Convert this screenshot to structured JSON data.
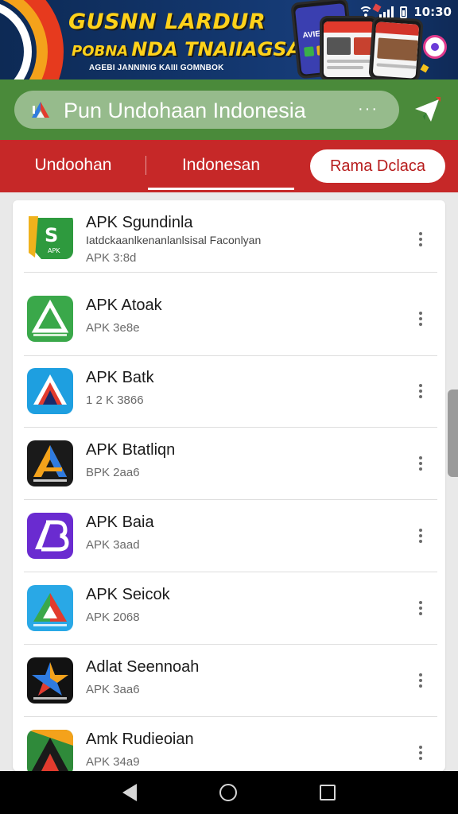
{
  "banner": {
    "title": "GUSNN LARDUR",
    "subtitle_small": "POBNA",
    "subtitle_large": "NDA TNAIIAGSA",
    "tagline": "AGEBI JANNINIG KAIII GOMNBOK",
    "phone_label": "AVIE"
  },
  "status_bar": {
    "time": "10:30"
  },
  "search": {
    "text": "Pun Undohaan Indonesia",
    "more": "···"
  },
  "tabs": [
    {
      "label": "Undoohan"
    },
    {
      "label": "Indonesan"
    }
  ],
  "tab_pill": {
    "label": "Rama Dclaca"
  },
  "apps": [
    {
      "title": "APK Sgundinla",
      "description": "Iatdckaanlkenanlanlsisal Faconlyan",
      "meta": "APK  3:8d",
      "icon": "green-s-logo-icon",
      "icon_color": "#2e9a3e"
    },
    {
      "title": "APK Atoak",
      "meta": "APK 3e8e",
      "icon": "green-triangle-icon",
      "icon_color": "#3aa84a"
    },
    {
      "title": "APK Batk",
      "meta": "1 2 K 3866",
      "icon": "blue-a-icon",
      "icon_color": "#1e9fe0"
    },
    {
      "title": "APK Btatliqn",
      "meta": "BPK 2aa6",
      "icon": "dark-a-icon",
      "icon_color": "#1a1a1a"
    },
    {
      "title": "APK Baia",
      "meta": "APK 3aad",
      "icon": "purple-ab-icon",
      "icon_color": "#6a2bd0"
    },
    {
      "title": "APK Seicok",
      "meta": "APK 2068",
      "icon": "cyan-triangle-icon",
      "icon_color": "#29a8e6"
    },
    {
      "title": "Adlat Seennoah",
      "meta": "APK 3aa6",
      "icon": "dark-star-icon",
      "icon_color": "#121212"
    },
    {
      "title": "Amk Rudieoian",
      "meta": "APK 34a9",
      "icon": "colorful-a-icon",
      "icon_color": "#2f8a3a"
    }
  ],
  "colors": {
    "header_green": "#4a8a3a",
    "tab_red": "#c62828",
    "banner_blue": "#12356b"
  }
}
